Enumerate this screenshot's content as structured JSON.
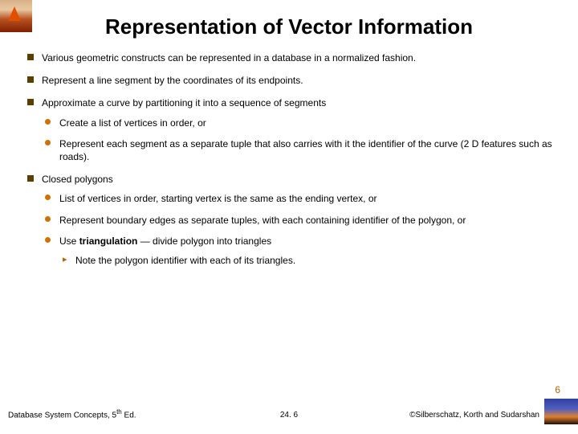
{
  "title": "Representation of Vector Information",
  "bullets": {
    "b1": "Various geometric constructs can be represented in a database in a normalized fashion.",
    "b2": "Represent a line segment by the coordinates of its endpoints.",
    "b3": "Approximate a curve by partitioning it into a sequence of segments",
    "b3a": "Create a list of vertices in order, or",
    "b3b": "Represent each segment as a separate tuple that also carries with it the identifier of the curve (2 D features such as roads).",
    "b4": "Closed polygons",
    "b4a": "List of vertices in order, starting vertex is the same as the ending vertex, or",
    "b4b": "Represent boundary edges as separate tuples, with each containing identifier of the polygon, or",
    "b4c_pre": "Use ",
    "b4c_term": "triangulation",
    "b4c_post": " — divide polygon into triangles",
    "b4c1": "Note the polygon identifier with each of its triangles."
  },
  "page_badge": "6",
  "footer": {
    "left_pre": "Database System Concepts, 5",
    "left_sup": "th",
    "left_post": " Ed.",
    "center": "24. 6",
    "right": "©Silberschatz, Korth and Sudarshan"
  }
}
